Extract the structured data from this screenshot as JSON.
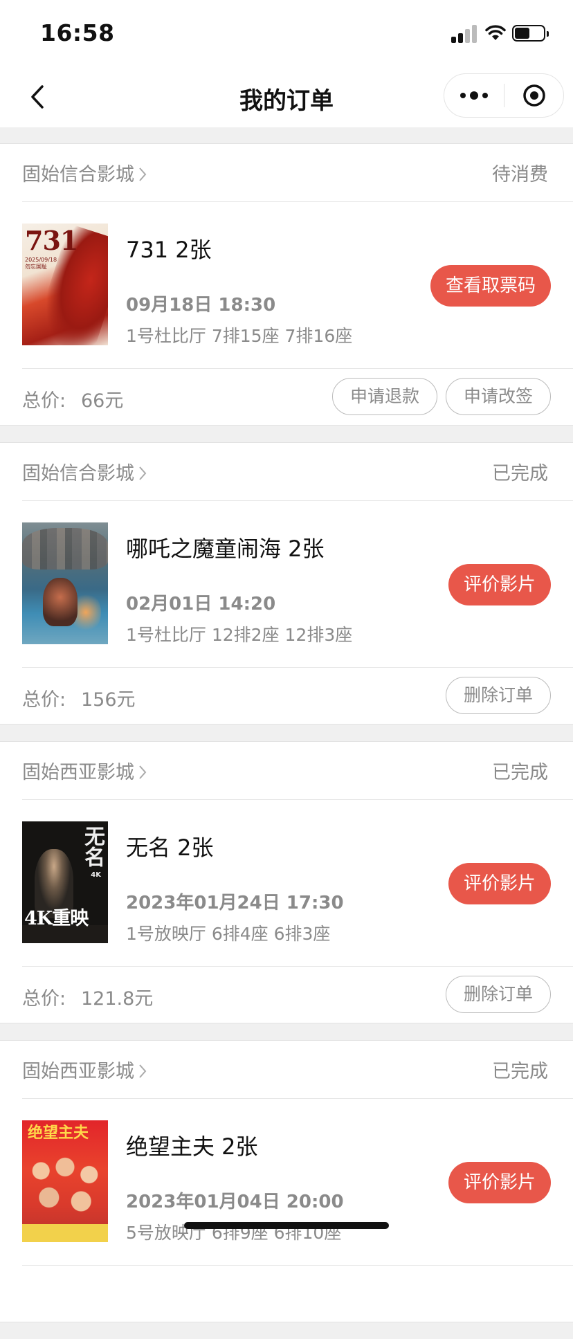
{
  "status_bar": {
    "time": "16:58",
    "battery_level": 0.55
  },
  "nav": {
    "title": "我的订单"
  },
  "orders": [
    {
      "cinema": "固始信合影城",
      "status": "待消费",
      "movie": "731 2张",
      "time": "09月18日 18:30",
      "seats": "1号杜比厅 7排15座 7排16座",
      "primary_action": "查看取票码",
      "total_label": "总价:",
      "total": "66元",
      "actions": [
        "申请退款",
        "申请改签"
      ]
    },
    {
      "cinema": "固始信合影城",
      "status": "已完成",
      "movie": "哪吒之魔童闹海 2张",
      "time": "02月01日 14:20",
      "seats": "1号杜比厅 12排2座 12排3座",
      "primary_action": "评价影片",
      "total_label": "总价:",
      "total": "156元",
      "actions": [
        "删除订单"
      ]
    },
    {
      "cinema": "固始西亚影城",
      "status": "已完成",
      "movie": "无名 2张",
      "time": "2023年01月24日 17:30",
      "seats": "1号放映厅 6排4座 6排3座",
      "primary_action": "评价影片",
      "total_label": "总价:",
      "total": "121.8元",
      "actions": [
        "删除订单"
      ]
    },
    {
      "cinema": "固始西亚影城",
      "status": "已完成",
      "movie": "绝望主夫 2张",
      "time": "2023年01月04日 20:00",
      "seats": "5号放映厅 6排9座 6排10座",
      "primary_action": "评价影片"
    }
  ],
  "posters": {
    "p1": {
      "title": "731",
      "date": "2025/09/18",
      "tagline": "勿忘国耻"
    },
    "p3": {
      "title": "无名",
      "badge": "4K",
      "rerelease": "4K重映"
    },
    "p4": {
      "title": "绝望主夫"
    }
  },
  "colors": {
    "accent": "#e8574a",
    "muted_text": "#8a8a8a",
    "background": "#f0f0f0"
  }
}
